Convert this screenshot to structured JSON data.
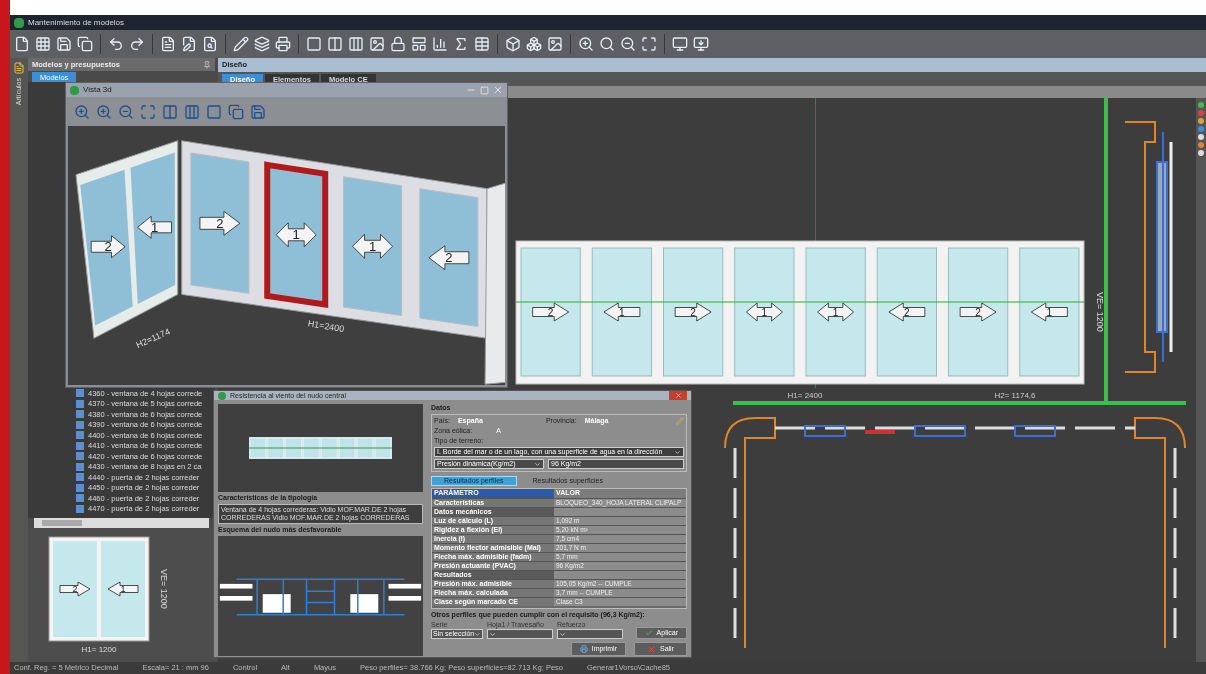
{
  "window": {
    "title": "Mantenimiento de modelos"
  },
  "left_panel": {
    "title": "Modelos y presupuestos",
    "side_tab": "Artículos",
    "tabs": [
      {
        "label": "Modelos",
        "selected": true
      }
    ],
    "items": [
      "4360 - ventana de 4 hojas correde",
      "4370 - ventana de 5 hojas correde",
      "4380 - ventana de 6 hojas correde",
      "4390 - ventana de 6 hojas correde",
      "4400 - ventana de 6 hojas correde",
      "4410 - ventana de 6 hojas correde",
      "4420 - ventana de 6 hojas correde",
      "4430 - ventana de 8 hojas en 2 ca",
      "4440 - puerta de 2 hojas correder",
      "4450 - puerta de 2 hojas correder",
      "4460 - puerta de 2 hojas correder",
      "4470 - puerta de 2 hojas correder"
    ],
    "preview": {
      "arrows": [
        {
          "label": "2",
          "kind": "right"
        },
        {
          "label": "1",
          "kind": "left"
        }
      ],
      "height_label": "VE= 1200",
      "width_label": "H1= 1200"
    }
  },
  "design_panel": {
    "title": "Diseño",
    "tabs": [
      {
        "label": "Diseño",
        "selected": true
      },
      {
        "label": "Elementos",
        "selected": false
      },
      {
        "label": "Modelo CE",
        "selected": false
      }
    ],
    "elevation": {
      "arrows": [
        {
          "label": "2",
          "kind": "right"
        },
        {
          "label": "1",
          "kind": "left"
        },
        {
          "label": "2",
          "kind": "right"
        },
        {
          "label": "1",
          "kind": "both"
        },
        {
          "label": "1",
          "kind": "both"
        },
        {
          "label": "2",
          "kind": "left"
        },
        {
          "label": "2",
          "kind": "right"
        },
        {
          "label": "1",
          "kind": "left"
        }
      ],
      "height_label": "VE= 1200",
      "width_labels": [
        "H1= 2400",
        "H2= 1174,6"
      ]
    }
  },
  "view_3d": {
    "title": "Vista 3d",
    "left_wall": [
      {
        "label": "2",
        "kind": "right"
      },
      {
        "label": "1",
        "kind": "left"
      }
    ],
    "main_wall": [
      {
        "label": "2",
        "kind": "right",
        "selected": false
      },
      {
        "label": "1",
        "kind": "both",
        "selected": true
      },
      {
        "label": "1",
        "kind": "both",
        "selected": false
      },
      {
        "label": "2",
        "kind": "left",
        "selected": false
      }
    ],
    "dimension_labels": [
      "H2=1174",
      "H1=2400"
    ]
  },
  "wind_dialog": {
    "title": "Resistencia al viento del nudo central",
    "typology_label": "Características de la tipología",
    "typology_text": "Ventana de 4 hojas correderas: Vidio MOF.MAR.DE 2 hojas CORREDERAS Vidio MOF.MAR.DE 2 hojas CORREDERAS",
    "scheme_label": "Esquema del nudo más desfavorable",
    "data_group": {
      "title": "Datos",
      "country_label": "País:",
      "country": "España",
      "province_label": "Provincia:",
      "province": "Málaga",
      "zone_label": "Zona eólica:",
      "zone": "A",
      "terrain_label": "Tipo de terreno:",
      "terrain": "I. Borde del mar o de un lago, con una superficie de agua en la dirección",
      "pressure_option": "Presión dinámica(Kg/m2)",
      "pressure_value": "96 Kg/m2"
    },
    "tabs": [
      {
        "label": "Resultados perfiles",
        "selected": true
      },
      {
        "label": "Resultados superficies",
        "selected": false
      }
    ],
    "table": {
      "columns": [
        "PARÁMETRO",
        "VALOR"
      ],
      "rows": [
        {
          "kind": "row",
          "cells": [
            "Características",
            "BLOQUEO_340_HOJA LATERAL CLIPALP"
          ]
        },
        {
          "kind": "section",
          "cells": [
            "Datos mecánicos"
          ]
        },
        {
          "kind": "row",
          "cells": [
            "Luz de cálculo (L)",
            "1,092 m"
          ]
        },
        {
          "kind": "row",
          "cells": [
            "Rigidez a flexión (EI)",
            "5,20 kN m²"
          ]
        },
        {
          "kind": "row",
          "cells": [
            "Inercia (I)",
            "7,5 cm4"
          ]
        },
        {
          "kind": "row",
          "cells": [
            "Momento flector admisible (Mal)",
            "201,7 N m"
          ]
        },
        {
          "kind": "row",
          "cells": [
            "Flecha máx. admisible (fadm)",
            "5,7 mm"
          ]
        },
        {
          "kind": "row",
          "cells": [
            "Presión actuante (PVAC)",
            "96 Kg/m2"
          ]
        },
        {
          "kind": "section",
          "cells": [
            "Resultados"
          ]
        },
        {
          "kind": "row",
          "cells": [
            "Presión máx. admisible",
            "105,05 Kg/m2 -- CUMPLE"
          ]
        },
        {
          "kind": "row",
          "cells": [
            "Flecha máx. calculada",
            "3,7 mm -- CUMPLE"
          ]
        },
        {
          "kind": "row",
          "cells": [
            "Clase según marcado CE",
            "Clase C3"
          ]
        }
      ]
    },
    "others_label": "Otros perfiles que pueden cumplir con el requisito (96,3 Kg/m2):",
    "filters": [
      {
        "label": "Serie",
        "value": "Sin selección"
      },
      {
        "label": "Hoja1 / Travesaño"
      },
      {
        "label": "Refuerzo"
      }
    ],
    "buttons": {
      "apply": "Aplicar",
      "print": "Imprimir",
      "exit": "Salir"
    }
  },
  "status_bar": [
    "Conf. Reg. = 5 Metrico Decimal",
    "Escala= 21 : mm 96",
    "Control",
    "Alt",
    "Mayus",
    "Peso perfiles= 38.766 Kg; Peso superficies=82.713 Kg; Peso",
    "Generar1Vorso\\Cache85"
  ]
}
